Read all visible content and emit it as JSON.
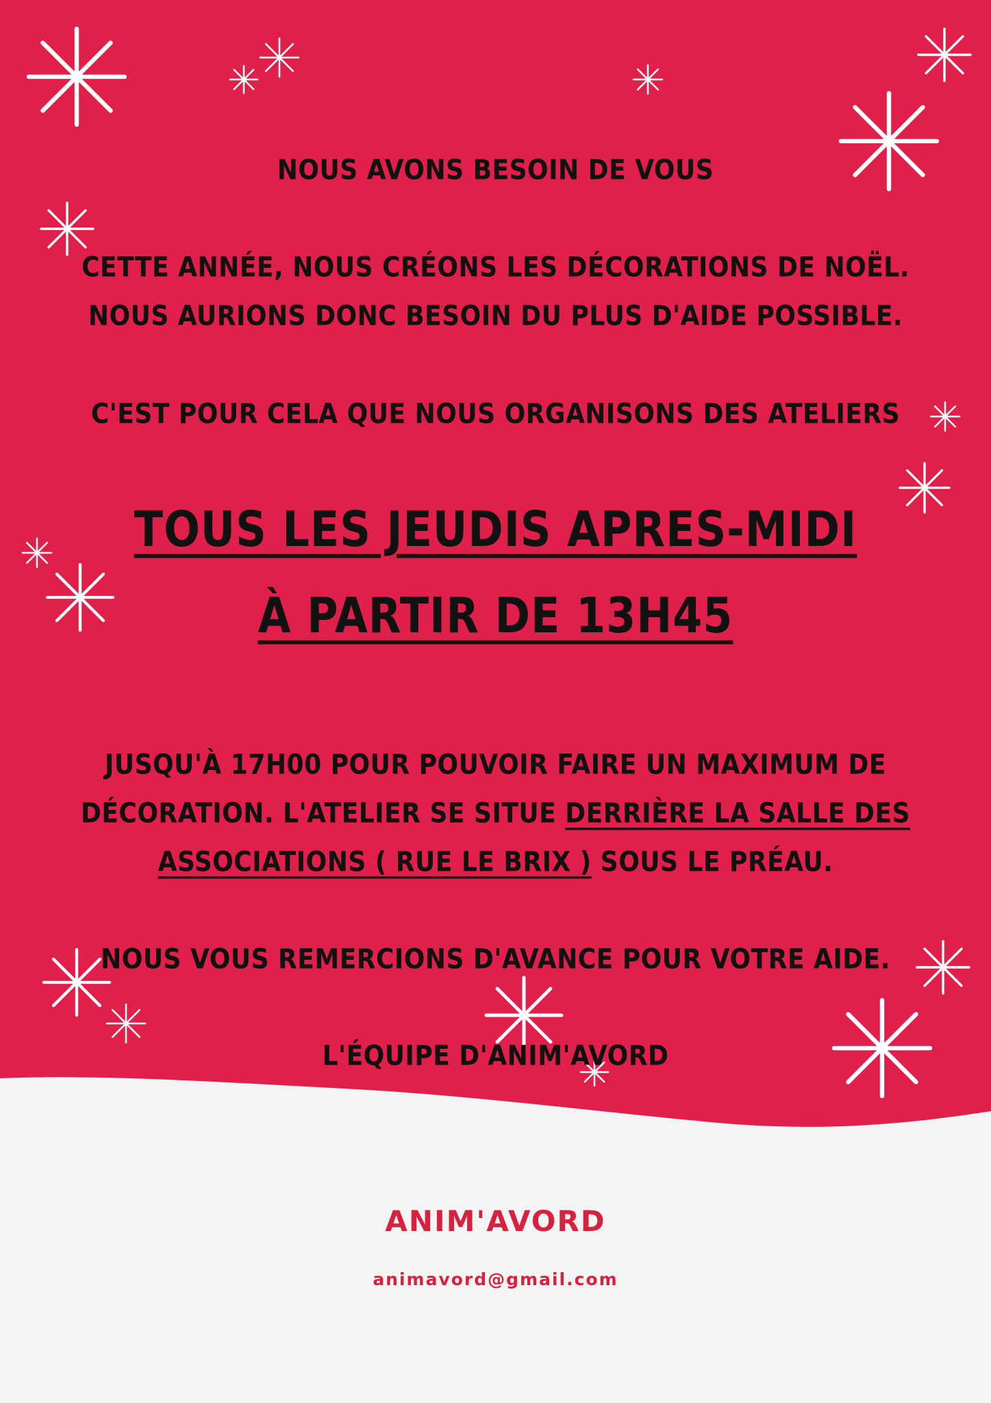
{
  "colors": {
    "red": "#e0204a",
    "white_band": "#f4f4f4",
    "text": "#111111",
    "snow": "#ffffff",
    "brand": "#d6213f"
  },
  "icons": [
    "snowflake-icon"
  ],
  "heading": "NOUS AVONS BESOIN DE VOUS",
  "paragraph1": {
    "line1": "CETTE ANNÉE, NOUS CRÉONS LES DÉCORATIONS DE NOËL.",
    "line2": "NOUS AURIONS DONC BESOIN DU PLUS D'AIDE POSSIBLE."
  },
  "paragraph2": "C'EST POUR CELA QUE NOUS ORGANISONS DES ATELIERS",
  "headline": {
    "line1": "TOUS LES JEUDIS APRES-MIDI",
    "line2": "À PARTIR DE 13H45"
  },
  "details": {
    "line1": "JUSQU'À 17H00 POUR POUVOIR FAIRE UN MAXIMUM DE",
    "line2_start": "DÉCORATION. L'ATELIER SE SITUE ",
    "line2_link": "DERRIÈRE LA SALLE DES",
    "line3_link": "ASSOCIATIONS ( RUE LE BRIX )",
    "line3_end": " SOUS LE PRÉAU."
  },
  "thanks": "NOUS VOUS REMERCIONS D'AVANCE POUR VOTRE AIDE.",
  "signature": "L'ÉQUIPE D'ANIM'AVORD",
  "footer": {
    "brand": "ANIM'AVORD",
    "email": "animavord@gmail.com"
  }
}
